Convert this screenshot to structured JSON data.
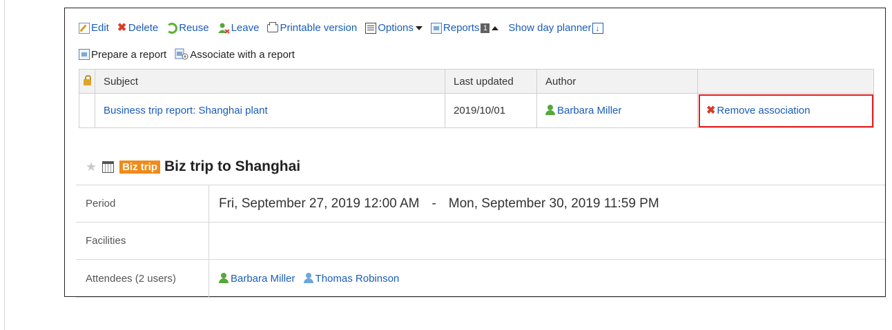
{
  "toolbar": {
    "edit": "Edit",
    "delete": "Delete",
    "reuse": "Reuse",
    "leave": "Leave",
    "printable": "Printable version",
    "options": "Options",
    "reports": "Reports",
    "reports_count": "1",
    "day_planner": "Show day planner",
    "prepare_report": "Prepare a report",
    "associate_report": "Associate with a report"
  },
  "reports_table": {
    "headers": [
      "Subject",
      "Last updated",
      "Author"
    ],
    "rows": [
      {
        "subject": "Business trip report: Shanghai plant",
        "updated": "2019/10/01",
        "author": "Barbara Miller",
        "action": "Remove association"
      }
    ]
  },
  "event": {
    "category": "Biz trip",
    "title": "Biz trip to Shanghai",
    "period_label": "Period",
    "period_start": "Fri, September 27, 2019 12:00 AM",
    "period_sep": "-",
    "period_end": "Mon, September 30, 2019 11:59 PM",
    "facilities_label": "Facilities",
    "facilities_value": "",
    "attendees_label": "Attendees (2 users)",
    "attendees": [
      "Barbara Miller",
      "Thomas Robinson"
    ]
  },
  "colors": {
    "link": "#1a5cb8",
    "category_badge": "#f08a19",
    "highlight_box": "#e02020",
    "delete_x": "#d93b2b"
  }
}
